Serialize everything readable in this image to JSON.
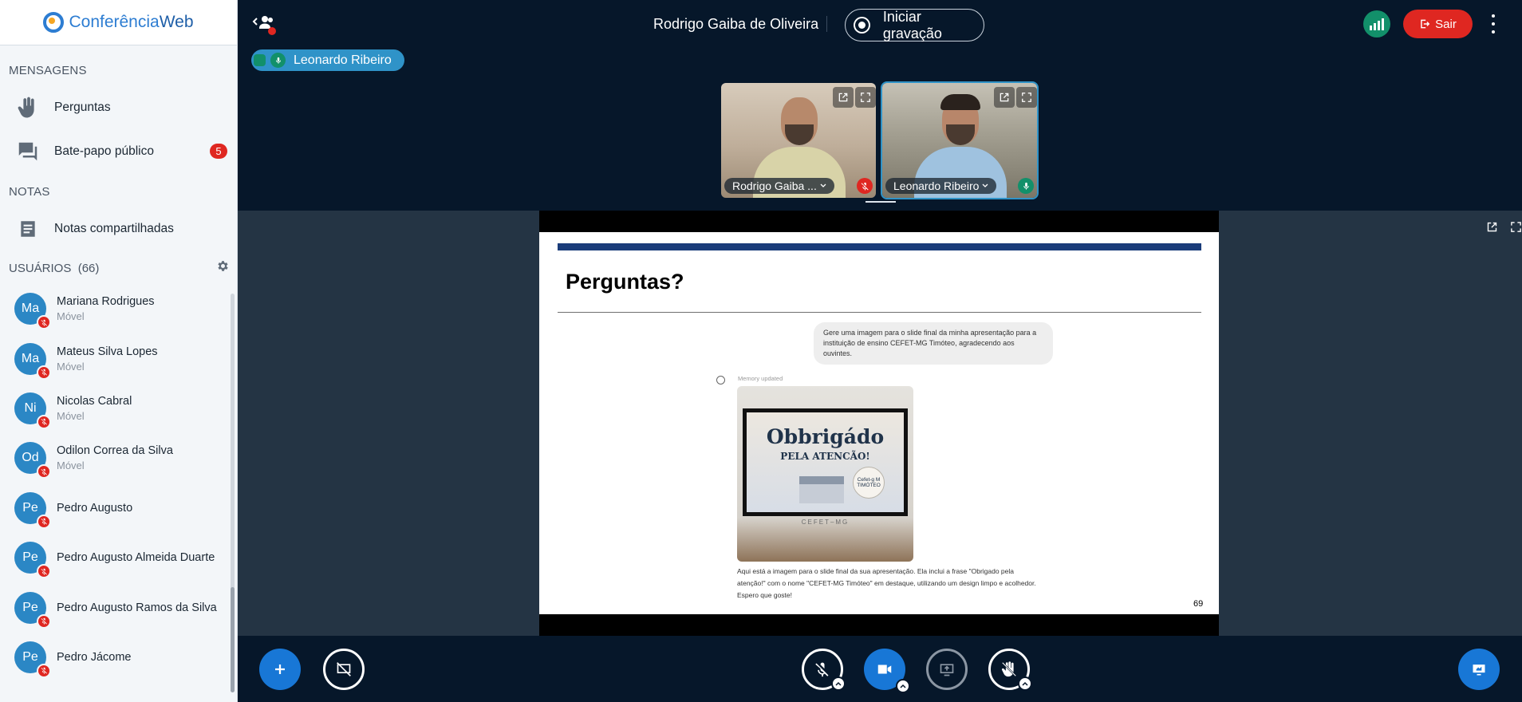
{
  "sidebar": {
    "brand": {
      "part1": "Conferência",
      "part2": "Web"
    },
    "messages_title": "MENSAGENS",
    "items": [
      {
        "label": "Perguntas",
        "icon": "raised-hand-icon"
      },
      {
        "label": "Bate-papo público",
        "icon": "chat-icon",
        "badge": "5"
      }
    ],
    "notes_title": "NOTAS",
    "notes_item": {
      "label": "Notas compartilhadas",
      "icon": "notes-icon"
    },
    "users_title": "USUÁRIOS",
    "users_count": "(66)",
    "users": [
      {
        "initials": "Ma",
        "name": "Mariana Rodrigues",
        "sub": "Móvel"
      },
      {
        "initials": "Ma",
        "name": "Mateus Silva Lopes",
        "sub": "Móvel"
      },
      {
        "initials": "Ni",
        "name": "Nicolas Cabral",
        "sub": "Móvel"
      },
      {
        "initials": "Od",
        "name": "Odilon Correa da Silva",
        "sub": "Móvel"
      },
      {
        "initials": "Pe",
        "name": "Pedro Augusto",
        "sub": ""
      },
      {
        "initials": "Pe",
        "name": "Pedro Augusto Almeida Duarte",
        "sub": ""
      },
      {
        "initials": "Pe",
        "name": "Pedro Augusto Ramos da Silva",
        "sub": ""
      },
      {
        "initials": "Pe",
        "name": "Pedro Jácome",
        "sub": ""
      }
    ]
  },
  "topbar": {
    "presenter": "Rodrigo Gaiba de Oliveira",
    "record_label": "Iniciar gravação",
    "exit_label": "Sair"
  },
  "talking": {
    "name": "Leonardo Ribeiro"
  },
  "videos": [
    {
      "label": "Rodrigo Gaiba ...",
      "muted": true
    },
    {
      "label": "Leonardo Ribeiro",
      "muted": false
    }
  ],
  "slide": {
    "title": "Perguntas?",
    "prompt": "Gere uma imagem para o slide final da minha apresentação para a instituição de ensino CEFET-MG Timóteo, agradecendo aos ouvintes.",
    "memory": "Memory updated",
    "image_title": "Obbrigádo",
    "image_subtitle": "PELA ATENCÃO!",
    "image_seal": "Cefet-g M TIMÓTEO",
    "image_stamp": "CEFET–MG",
    "caption": "Aqui está a imagem para o slide final da sua apresentação. Ela inclui a frase \"Obrigado pela atenção!\" com o nome \"CEFET-MG Timóteo\" em destaque, utilizando um design limpo e acolhedor. Espero que goste!",
    "page": "69"
  },
  "colors": {
    "accent": "#2f93c8",
    "danger": "#df2721",
    "success": "#12906a",
    "primary": "#1877d6",
    "background": "#06172a"
  }
}
